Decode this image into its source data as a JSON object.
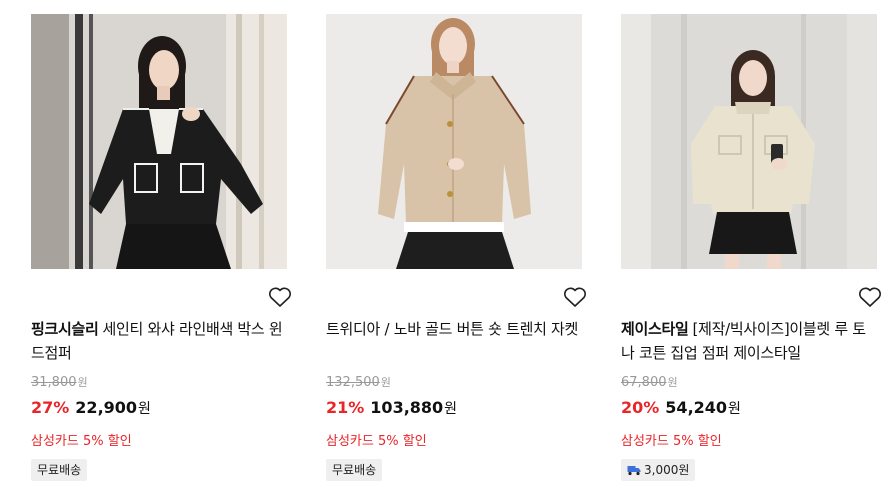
{
  "products": [
    {
      "brand": "핑크시슬리",
      "name": "세인티 와샤 라인배색 박스 윈드점퍼",
      "original_price": "31,800",
      "original_unit": "원",
      "discount": "27%",
      "price": "22,900",
      "price_unit": "원",
      "card_promo": "삼성카드 5% 할인",
      "shipping": "무료배송",
      "image_icon": "product-photo-black-jacket"
    },
    {
      "brand": "",
      "name": "트위디아 / 노바 골드 버튼 숏 트렌치 자켓",
      "original_price": "132,500",
      "original_unit": "원",
      "discount": "21%",
      "price": "103,880",
      "price_unit": "원",
      "card_promo": "삼성카드 5% 할인",
      "shipping": "무료배송",
      "image_icon": "product-photo-beige-trench"
    },
    {
      "brand": "제이스타일",
      "name": "[제작/빅사이즈]이블렛 루 토나 코튼 집업 점퍼 제이스타일",
      "original_price": "67,800",
      "original_unit": "원",
      "discount": "20%",
      "price": "54,240",
      "price_unit": "원",
      "card_promo": "삼성카드 5% 할인",
      "shipping": "3,000원",
      "shipping_icon": "truck-icon",
      "image_icon": "product-photo-cream-jumper"
    }
  ],
  "wishlist_icon": "heart-outline-icon",
  "colors": {
    "discount": "#e8262a",
    "promo": "#e8262a",
    "strike_price": "#999999",
    "badge_bg": "#efefef"
  }
}
